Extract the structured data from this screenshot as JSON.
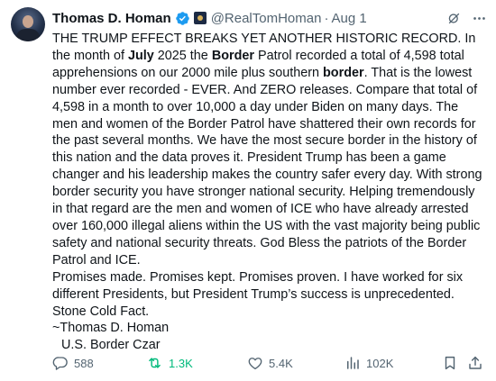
{
  "author": {
    "name": "Thomas D. Homan",
    "handle": "@RealTomHoman",
    "separator": "·",
    "date": "Aug 1"
  },
  "tweet": {
    "p1": [
      "THE TRUMP EFFECT BREAKS YET ANOTHER HISTORIC RECORD.  In the month of ",
      "July",
      " 2025 the ",
      "Border",
      " Patrol recorded a total of 4,598 total apprehensions on our 2000 mile plus southern ",
      "border",
      ". That is the lowest number ever recorded - EVER.  And ZERO releases.  Compare that total of 4,598 in a month to over 10,000 a day under Biden on many days.  The men and women of the Border Patrol have shattered their own records for the past several months. We have the most secure border in the history of this nation and the data proves it. President Trump has been a game changer and his leadership makes the country safer every day. With strong border security  you have stronger national security.  Helping tremendously in that regard are the men and women of ICE who have already arrested over 160,000 illegal aliens within the US with the vast majority being public safety and national security threats.  God Bless the patriots of the Border Patrol and ICE."
    ],
    "p2": "Promises made. Promises kept. Promises proven.  I have worked for six different Presidents, but President Trump’s success is unprecedented. Stone Cold Fact.",
    "sig1": "~Thomas D. Homan",
    "sig2": "U.S. Border Czar"
  },
  "metrics": {
    "replies": "588",
    "reposts": "1.3K",
    "likes": "5.4K",
    "views": "102K"
  },
  "icons": {
    "verified": "verified-check-icon",
    "affiliation": "affiliation-badge-icon",
    "grok": "grok-icon",
    "more": "more-options-icon",
    "reply": "reply-icon",
    "repost": "repost-icon",
    "like": "like-icon",
    "views": "views-icon",
    "bookmark": "bookmark-icon",
    "share": "share-icon"
  },
  "colors": {
    "verified": "#1d9bf0",
    "repost_active": "#00ba7c",
    "secondary_text": "#536471"
  }
}
